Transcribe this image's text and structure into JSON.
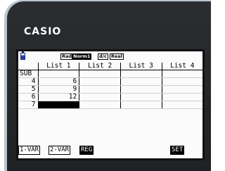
{
  "brand": "CASIO",
  "status": {
    "angle": "Rad",
    "mode": "Norm1",
    "frac": "d/c",
    "number_format": "Real"
  },
  "table": {
    "columns": [
      "List 1",
      "List 2",
      "List 3",
      "List 4"
    ],
    "rows": [
      {
        "label": "SUB",
        "cells": [
          "",
          "",
          "",
          ""
        ]
      },
      {
        "label": "4",
        "cells": [
          "6",
          "",
          "",
          ""
        ]
      },
      {
        "label": "5",
        "cells": [
          "9",
          "",
          "",
          ""
        ]
      },
      {
        "label": "6",
        "cells": [
          "12",
          "",
          "",
          ""
        ]
      },
      {
        "label": "7",
        "cells": [
          "",
          "",
          "",
          ""
        ]
      }
    ]
  },
  "fkeys": [
    "1-VAR",
    "2-VAR",
    "REG",
    "SET"
  ],
  "icons": {
    "battery": "battery-icon"
  }
}
